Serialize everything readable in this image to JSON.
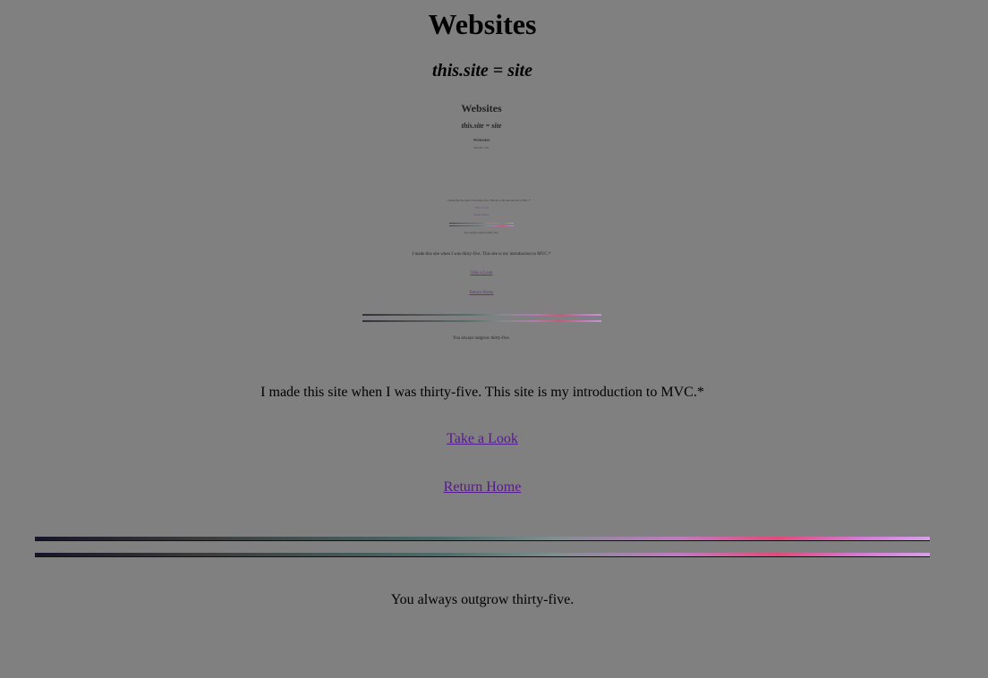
{
  "header": {
    "title": "Websites",
    "subtitle": "this.site = site"
  },
  "main": {
    "intro": "I made this site when I was thirty-five. This site is my introduction to MVC.*",
    "links": [
      {
        "label": "Take a Look"
      },
      {
        "label": "Return Home"
      }
    ],
    "footer": "You always outgrow thirty-five."
  },
  "colors": {
    "background": "#808080",
    "link": "#551a8b",
    "text": "#000000",
    "rule_gradient": [
      "#15152a",
      "#3a3a3a",
      "#4d6b6b",
      "#7f8f8f",
      "#c27ac2",
      "#e24a7a",
      "#d479d4",
      "#d6a0e8"
    ]
  }
}
